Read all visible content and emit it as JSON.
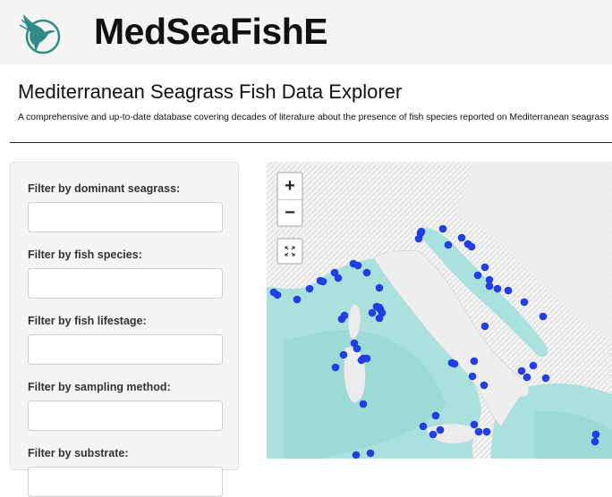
{
  "header": {
    "app_name": "MedSeaFishE",
    "subtitle": "Mediterranean Seagrass Fish Data Explorer",
    "description": "A comprehensive and up-to-date database covering decades of literature about the presence of fish species reported on Mediterranean seagrass meadows."
  },
  "filters": [
    {
      "label": "Filter by dominant seagrass:",
      "value": ""
    },
    {
      "label": "Filter by fish species:",
      "value": ""
    },
    {
      "label": "Filter by fish lifestage:",
      "value": ""
    },
    {
      "label": "Filter by sampling method:",
      "value": ""
    },
    {
      "label": "Filter by substrate:",
      "value": ""
    }
  ],
  "map": {
    "zoom_in_label": "+",
    "zoom_out_label": "−",
    "marker_color": "#1f3ff0",
    "sea_color": "#a9e1dc",
    "land_color": "#f2f2f2",
    "icons": [
      "bird-logo-icon",
      "fullscreen-icon"
    ]
  }
}
